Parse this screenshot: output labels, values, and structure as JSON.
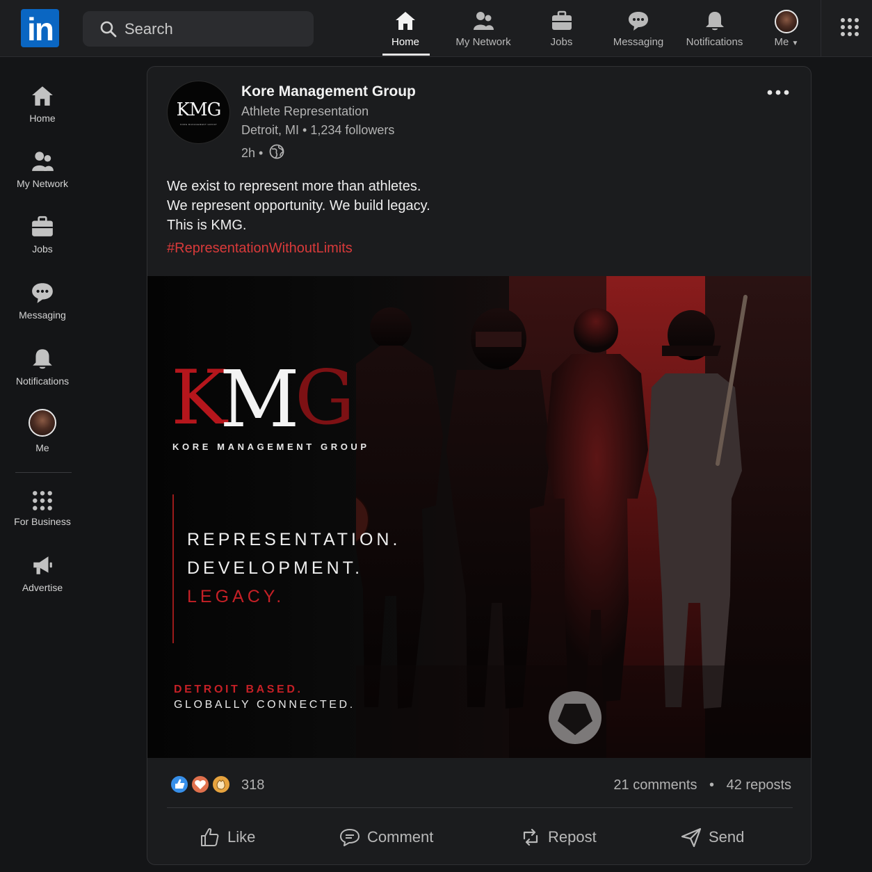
{
  "topnav": {
    "logo": "in",
    "search_placeholder": "Search",
    "items": [
      {
        "label": "Home",
        "icon": "home-icon",
        "active": true
      },
      {
        "label": "My Network",
        "icon": "network-icon"
      },
      {
        "label": "Jobs",
        "icon": "briefcase-icon"
      },
      {
        "label": "Messaging",
        "icon": "messaging-icon"
      },
      {
        "label": "Notifications",
        "icon": "bell-icon"
      },
      {
        "label": "Me",
        "icon": "avatar"
      }
    ],
    "apps_icon": "grid-icon"
  },
  "sidebar": {
    "items": [
      {
        "label": "Home",
        "icon": "home-icon"
      },
      {
        "label": "My Network",
        "icon": "network-icon"
      },
      {
        "label": "Jobs",
        "icon": "briefcase-icon"
      },
      {
        "label": "Messaging",
        "icon": "messaging-icon"
      },
      {
        "label": "Notifications",
        "icon": "bell-icon"
      },
      {
        "label": "Me",
        "icon": "avatar"
      },
      {
        "label": "For Business",
        "icon": "grid-icon"
      },
      {
        "label": "Advertise",
        "icon": "megaphone-icon"
      }
    ]
  },
  "post": {
    "avatar_monogram": "KMG",
    "avatar_subtext": "KORE MANAGEMENT GROUP",
    "author": "Kore Management Group",
    "headline": "Athlete Representation",
    "meta": "Detroit, MI • 1,234 followers",
    "time": "2h •",
    "body_lines": [
      "We exist to represent more than athletes.",
      "We represent opportunity. We build legacy.",
      "This is KMG."
    ],
    "hashtag": "#RepresentationWithoutLimits",
    "image": {
      "logo_text": "KMG",
      "logo_subtitle": "KORE MANAGEMENT GROUP",
      "tagline": [
        "REPRESENTATION.",
        "DEVELOPMENT.",
        "LEGACY."
      ],
      "location_1": "DETROIT BASED.",
      "location_2": "GLOBALLY CONNECTED."
    },
    "reaction_count": "318",
    "comments": "21 comments",
    "reposts": "42 reposts",
    "actions": [
      "Like",
      "Comment",
      "Repost",
      "Send"
    ]
  },
  "colors": {
    "brand_blue": "#0a66c2",
    "accent_red": "#c52026",
    "background": "#141517",
    "card": "#1b1c1e"
  }
}
